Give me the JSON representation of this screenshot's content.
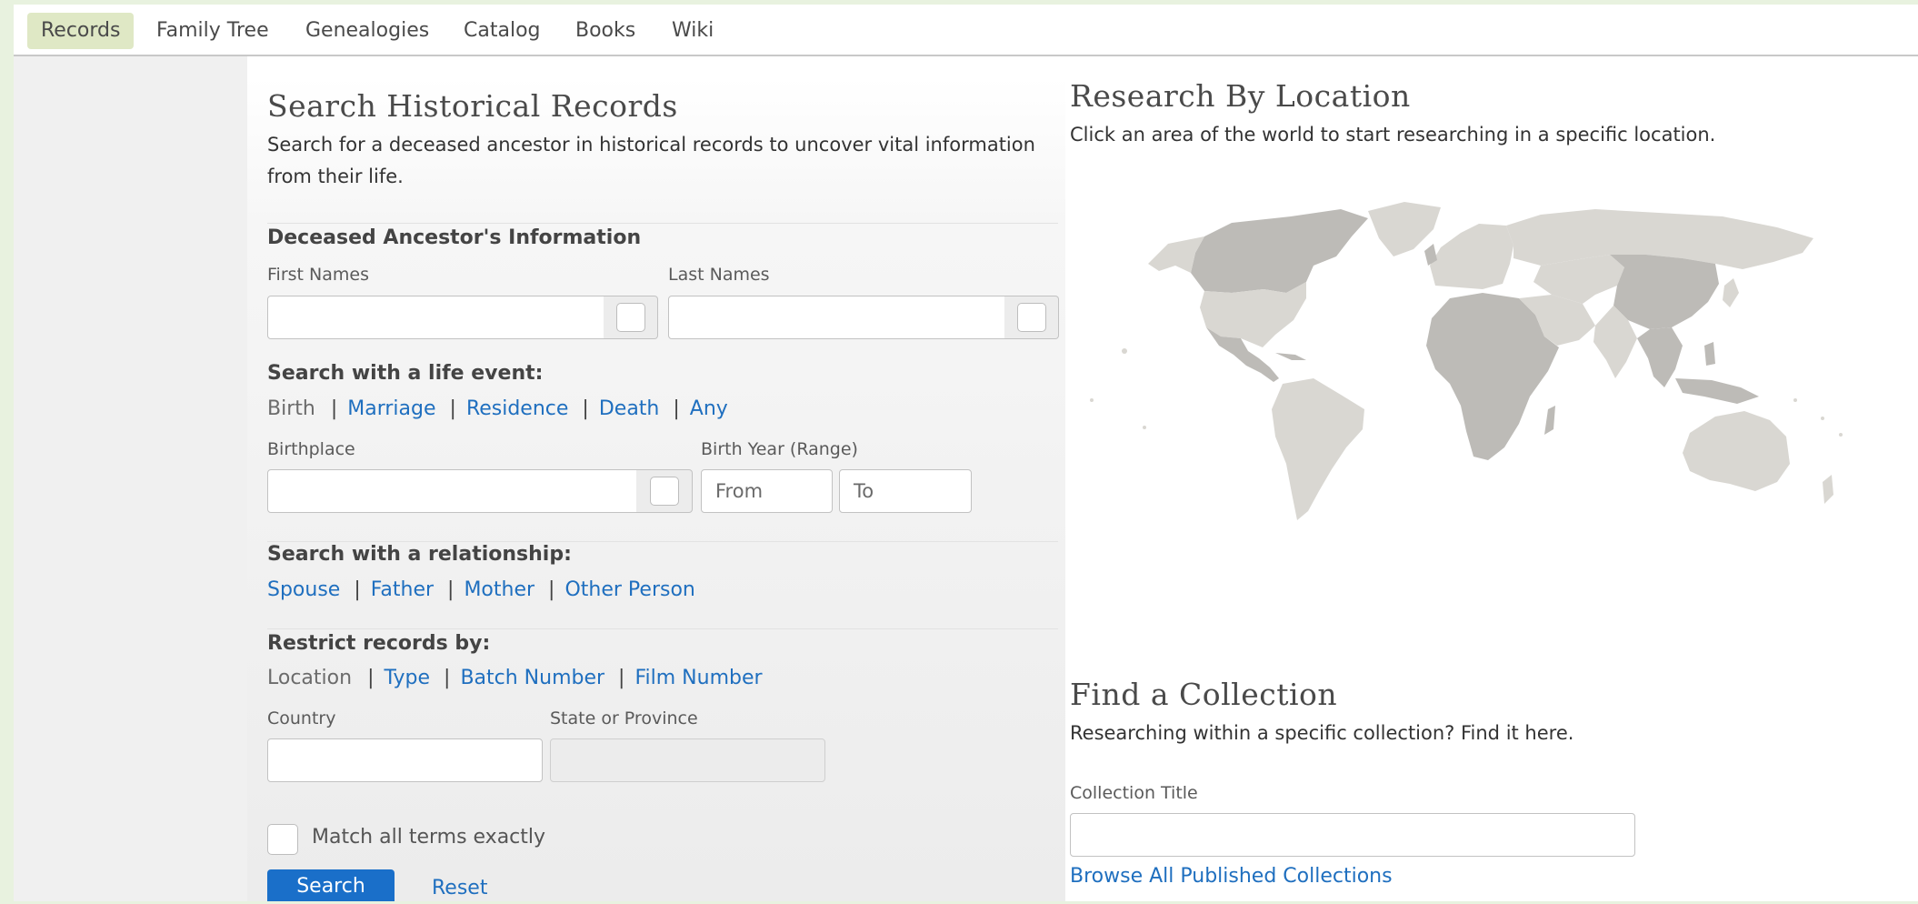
{
  "nav": {
    "items": [
      {
        "label": "Records",
        "active": true
      },
      {
        "label": "Family Tree"
      },
      {
        "label": "Genealogies"
      },
      {
        "label": "Catalog"
      },
      {
        "label": "Books"
      },
      {
        "label": "Wiki"
      }
    ]
  },
  "search": {
    "title": "Search Historical Records",
    "description": "Search for a deceased ancestor in historical records to uncover vital information from their life.",
    "ancestor_heading": "Deceased Ancestor's Information",
    "first_names_label": "First Names",
    "last_names_label": "Last Names",
    "life_event_heading": "Search with a life event:",
    "life_events": {
      "birth": "Birth",
      "marriage": "Marriage",
      "residence": "Residence",
      "death": "Death",
      "any": "Any"
    },
    "separator": "|",
    "birthplace_label": "Birthplace",
    "birth_year_label": "Birth Year (Range)",
    "from_placeholder": "From",
    "to_placeholder": "To",
    "relationship_heading": "Search with a relationship:",
    "relationships": {
      "spouse": "Spouse",
      "father": "Father",
      "mother": "Mother",
      "other": "Other Person"
    },
    "restrict_heading": "Restrict records by:",
    "restrict": {
      "location": "Location",
      "type": "Type",
      "batch": "Batch Number",
      "film": "Film Number"
    },
    "country_label": "Country",
    "state_label": "State or Province",
    "match_label": "Match all terms exactly",
    "search_button": "Search",
    "reset_link": "Reset"
  },
  "location": {
    "title": "Research By Location",
    "description": "Click an area of the world to start researching in a specific location."
  },
  "collection": {
    "title": "Find a Collection",
    "description": "Researching within a specific collection? Find it here.",
    "title_label": "Collection Title",
    "browse_link": "Browse All Published Collections"
  },
  "colors": {
    "link": "#1f6fbf",
    "primary_button": "#1a6fc9",
    "nav_active": "#dfe8c5",
    "map_dark": "#bdbbb7",
    "map_light": "#d9d7d2"
  }
}
